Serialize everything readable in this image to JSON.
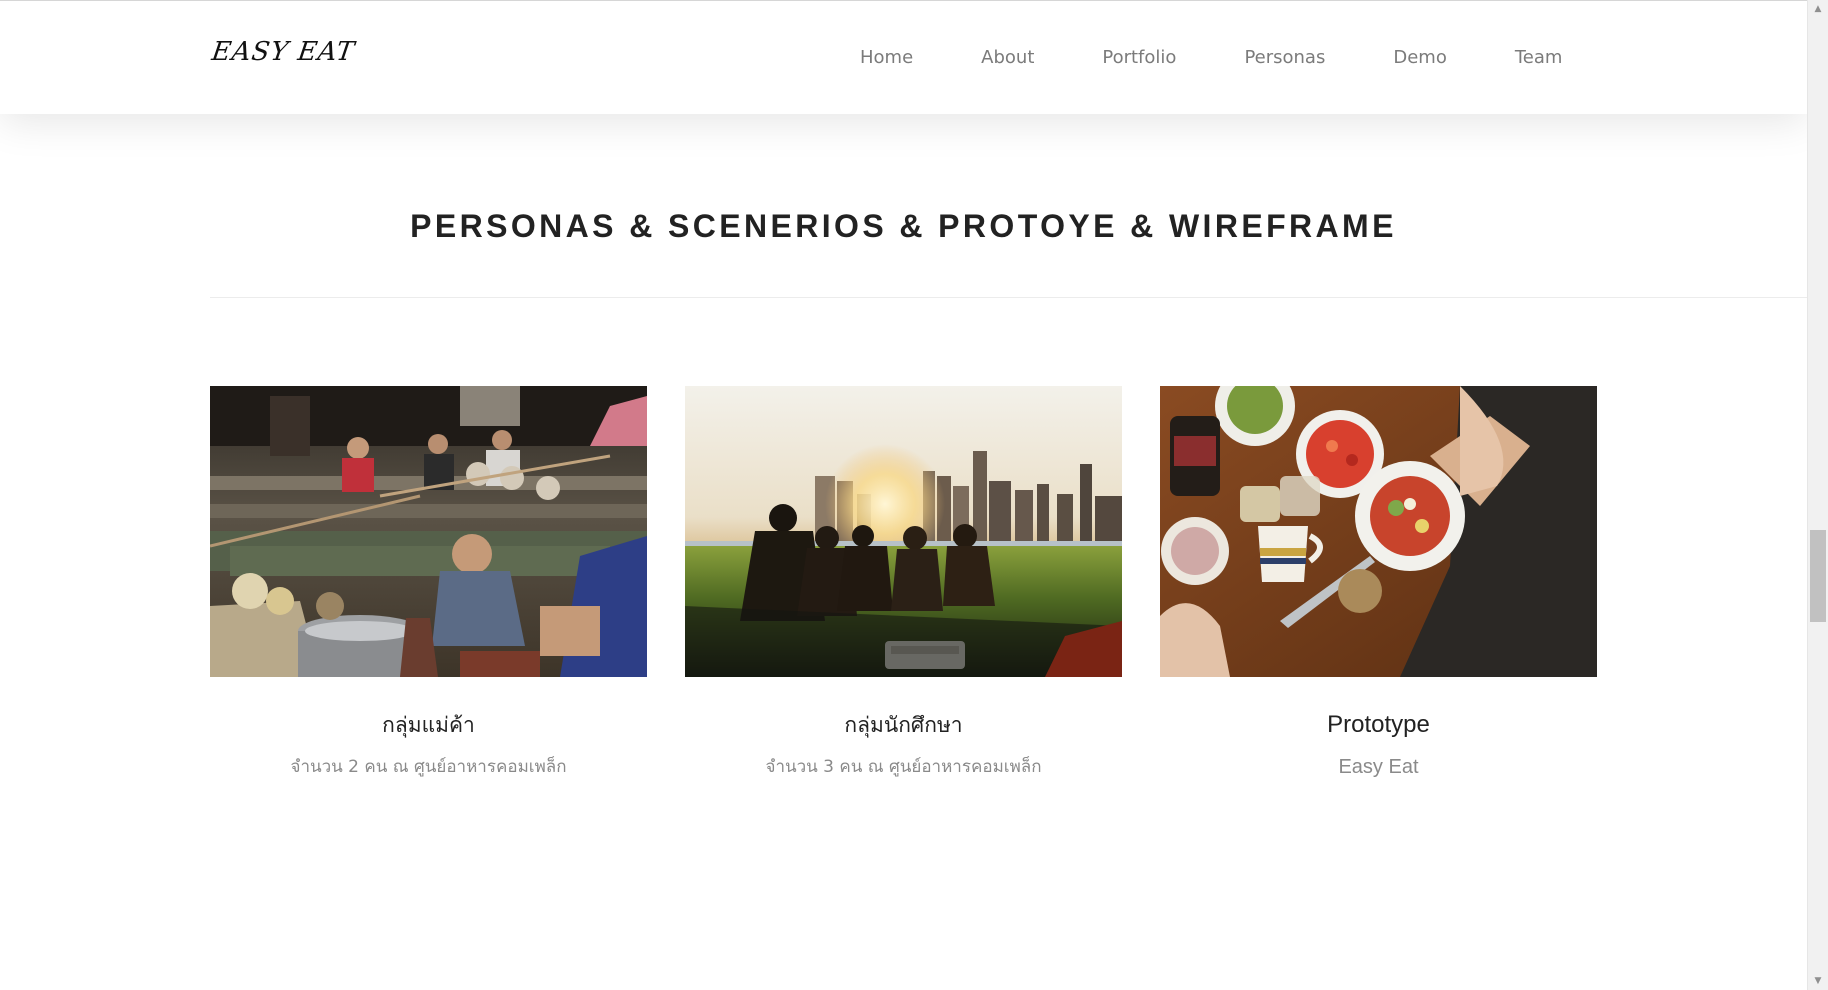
{
  "header": {
    "brand": "EASY EAT",
    "nav": [
      {
        "label": "Home"
      },
      {
        "label": "About"
      },
      {
        "label": "Portfolio"
      },
      {
        "label": "Personas"
      },
      {
        "label": "Demo"
      },
      {
        "label": "Team"
      }
    ]
  },
  "section": {
    "title": "PERSONAS & SCENERIOS & PROTOYE & WIREFRAME"
  },
  "cards": [
    {
      "title": "กลุ่มแม่ค้า",
      "subtitle": "จำนวน 2 คน ณ ศูนย์อาหารคอมเพล็ก"
    },
    {
      "title": "กลุ่มนักศึกษา",
      "subtitle": "จำนวน 3 คน ณ ศูนย์อาหารคอมเพล็ก"
    },
    {
      "title": "Prototype",
      "subtitle": "Easy Eat"
    }
  ],
  "colors": {
    "nav_text": "#7b7b7b",
    "title_text": "#222222",
    "subtitle_text": "#8a8a8a"
  }
}
